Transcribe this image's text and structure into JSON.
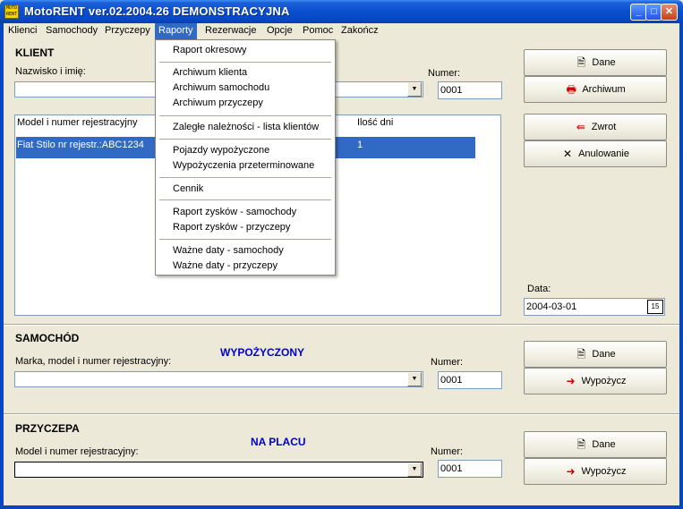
{
  "window": {
    "title": "MotoRENT ver.02.2004.26 DEMONSTRACYJNA",
    "icon_label": "MOTO RENT",
    "minimize": "_",
    "maximize": "□",
    "close": "✕"
  },
  "menubar": {
    "items": [
      {
        "label": "Klienci"
      },
      {
        "label": "Samochody"
      },
      {
        "label": "Przyczepy"
      },
      {
        "label": "Raporty"
      },
      {
        "label": "Rezerwacje"
      },
      {
        "label": "Opcje"
      },
      {
        "label": "Pomoc"
      },
      {
        "label": "Zakończ"
      }
    ],
    "open_menu": "Raporty"
  },
  "raporty_menu": {
    "groups": [
      [
        "Raport okresowy"
      ],
      [
        "Archiwum klienta",
        "Archiwum samochodu",
        "Archiwum przyczepy"
      ],
      [
        "Zaległe należności - lista klientów"
      ],
      [
        "Pojazdy wypożyczone",
        "Wypożyczenia przeterminowane"
      ],
      [
        "Cennik"
      ],
      [
        "Raport zysków - samochody",
        "Raport zysków - przyczepy"
      ],
      [
        "Ważne daty - samochody",
        "Ważne daty - przyczepy"
      ]
    ]
  },
  "klient": {
    "title": "KLIENT",
    "name_label": "Nazwisko i imię:",
    "name_value": "",
    "number_label": "Numer:",
    "number_value": "0001",
    "list_headers": [
      "Model i numer rejestracyjny",
      "Ilość dni"
    ],
    "list_rows": [
      {
        "model": "Fiat Stilo nr rejestr.:ABC1234",
        "days": "1"
      }
    ],
    "buttons": {
      "dane": "Dane",
      "archiwum": "Archiwum",
      "zwrot": "Zwrot",
      "anulowanie": "Anulowanie"
    },
    "date_label": "Data:",
    "date_value": "2004-03-01",
    "calendar_icon": "15"
  },
  "samochod": {
    "title": "SAMOCHÓD",
    "status": "WYPOŻYCZONY",
    "model_label": "Marka, model i numer rejestracyjny:",
    "model_value": "",
    "number_label": "Numer:",
    "number_value": "0001",
    "buttons": {
      "dane": "Dane",
      "wypozycz": "Wypożycz"
    }
  },
  "przyczepa": {
    "title": "PRZYCZEPA",
    "status": "NA PLACU",
    "model_label": "Model i numer rejestracyjny:",
    "model_value": "",
    "number_label": "Numer:",
    "number_value": "0001",
    "buttons": {
      "dane": "Dane",
      "wypozycz": "Wypożycz"
    }
  },
  "colors": {
    "accent": "#316ac5",
    "status_blue": "#0000c8",
    "titlebar": "#0a4fd0"
  }
}
